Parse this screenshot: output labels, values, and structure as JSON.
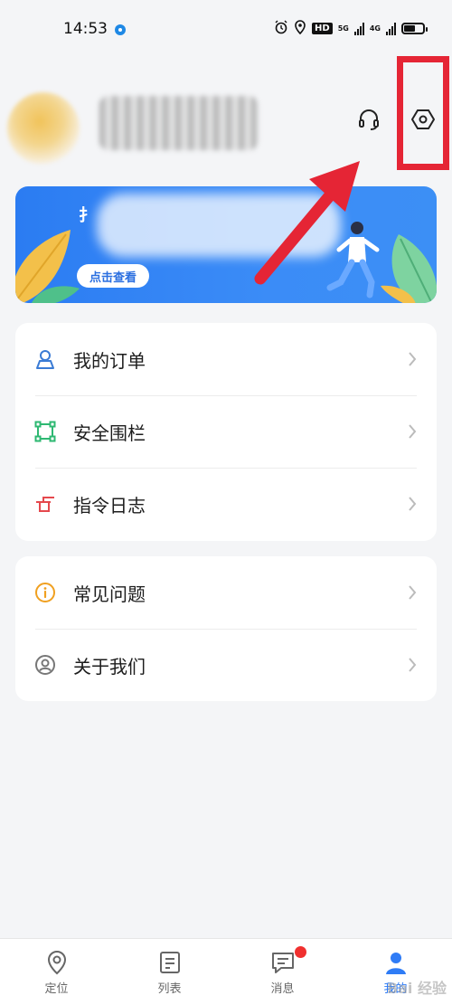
{
  "status_bar": {
    "time": "14:53",
    "hd_label": "HD",
    "net1": "5G",
    "net2": "4G"
  },
  "banner": {
    "title_partial": "扌",
    "button_label": "点击查看"
  },
  "menu": {
    "group1": [
      {
        "label": "我的订单",
        "icon": "person-icon",
        "color": "#3a7bd5"
      },
      {
        "label": "安全围栏",
        "icon": "fence-icon",
        "color": "#2eb872"
      },
      {
        "label": "指令日志",
        "icon": "command-icon",
        "color": "#e5484d"
      }
    ],
    "group2": [
      {
        "label": "常见问题",
        "icon": "info-icon",
        "color": "#f0a020"
      },
      {
        "label": "关于我们",
        "icon": "user-circle-icon",
        "color": "#777777"
      }
    ]
  },
  "bottom_nav": [
    {
      "label": "定位",
      "icon": "location-pin-icon",
      "active": false
    },
    {
      "label": "列表",
      "icon": "list-icon",
      "active": false
    },
    {
      "label": "消息",
      "icon": "message-icon",
      "active": false,
      "badge": true
    },
    {
      "label": "我的",
      "icon": "user-icon",
      "active": true
    }
  ],
  "watermark": "Bai 经验",
  "colors": {
    "accent": "#2f7cf6",
    "annotation": "#e52535",
    "background": "#f4f5f7"
  }
}
